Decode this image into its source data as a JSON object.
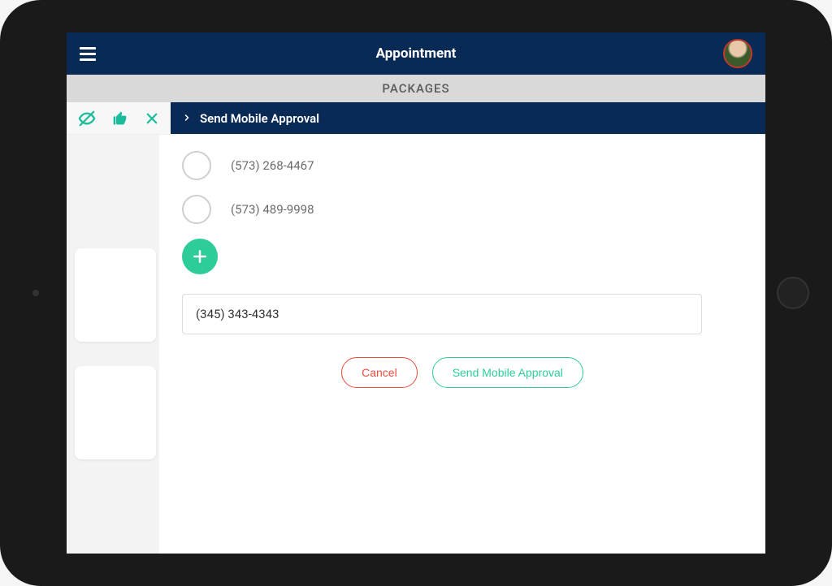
{
  "header": {
    "title": "Appointment"
  },
  "subheader": {
    "label": "PACKAGES"
  },
  "panel": {
    "title": "Send Mobile Approval"
  },
  "phones": [
    {
      "number": "(573) 268-4467"
    },
    {
      "number": "(573) 489-9998"
    }
  ],
  "phone_input": {
    "value": "(345) 343-4343"
  },
  "buttons": {
    "cancel": "Cancel",
    "send": "Send Mobile Approval"
  },
  "colors": {
    "primary_dark": "#0a2a56",
    "accent_green": "#2ecc9a",
    "accent_red": "#e74c3c"
  }
}
